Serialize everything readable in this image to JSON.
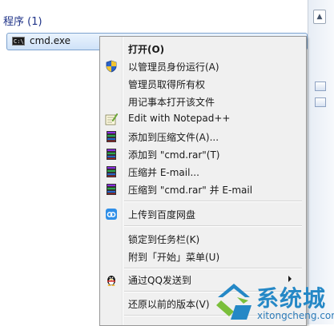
{
  "search_results": {
    "section_title": "程序 (1)",
    "result": {
      "label": "cmd.exe",
      "icon": "cmd-console-icon",
      "icon_text": "C:\\"
    }
  },
  "right_strip": {
    "arrow": "▲"
  },
  "context_menu": {
    "items": [
      {
        "label": "打开(O)",
        "bold": true,
        "icon": ""
      },
      {
        "label": "以管理员身份运行(A)",
        "icon": "uac-shield-icon"
      },
      {
        "label": "管理员取得所有权",
        "icon": ""
      },
      {
        "label": "用记事本打开该文件",
        "icon": ""
      },
      {
        "label": "Edit with Notepad++",
        "icon": "notepadpp-icon"
      },
      {
        "label": "添加到压缩文件(A)...",
        "icon": "winrar-icon"
      },
      {
        "label": "添加到 \"cmd.rar\"(T)",
        "icon": "winrar-icon"
      },
      {
        "label": "压缩并 E-mail...",
        "icon": "winrar-icon"
      },
      {
        "label": "压缩到 \"cmd.rar\" 并 E-mail",
        "icon": "winrar-icon"
      },
      {
        "label": "上传到百度网盘",
        "icon": "baidu-netdisk-icon"
      },
      {
        "label": "锁定到任务栏(K)",
        "icon": ""
      },
      {
        "label": "附到「开始」菜单(U)",
        "icon": ""
      },
      {
        "label": "通过QQ发送到",
        "icon": "qq-penguin-icon",
        "submenu": true
      },
      {
        "label": "还原以前的版本(V)",
        "icon": ""
      }
    ]
  },
  "watermark": {
    "title": "系统城",
    "url": "xitongcheng.com",
    "colors": {
      "blue": "#2588c6",
      "green": "#7bbf3b"
    }
  }
}
